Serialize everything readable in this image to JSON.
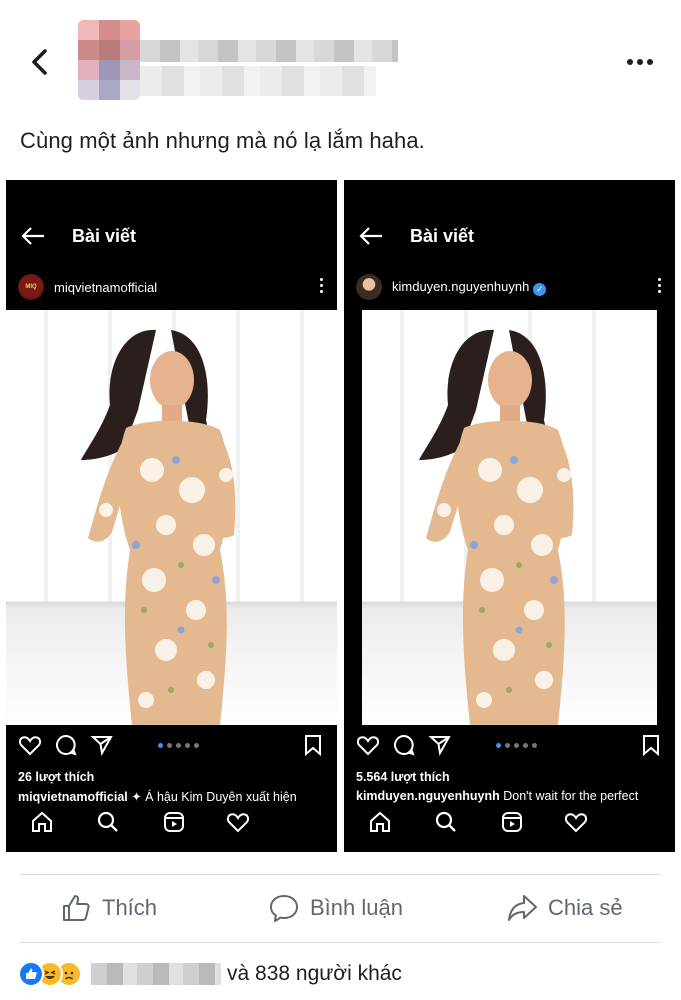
{
  "post": {
    "caption": "Cùng một ảnh nhưng mà nó lạ lắm haha."
  },
  "panels": [
    {
      "title": "Bài viết",
      "username": "miqvietnamofficial",
      "verified": false,
      "likes": "26 lượt thích",
      "caption_user": "miqvietnamofficial",
      "caption_text": " ✦ Á hậu Kim Duyên xuất hiện",
      "avatar_text": "MIQ"
    },
    {
      "title": "Bài viết",
      "username": "kimduyen.nguyenhuynh",
      "verified": true,
      "likes": "5.564 lượt thích",
      "caption_user": "kimduyen.nguyenhuynh",
      "caption_text": " Don't wait for the perfect",
      "avatar_text": ""
    }
  ],
  "actions": {
    "like": "Thích",
    "comment": "Bình luận",
    "share": "Chia sẻ"
  },
  "reactions": {
    "summary": "và 838 người khác",
    "types": [
      "like-icon",
      "haha-icon",
      "sad-icon"
    ]
  },
  "colors": {
    "fb_blue": "#1877f2",
    "ig_blue": "#3897f0",
    "text_gray": "#606770"
  }
}
